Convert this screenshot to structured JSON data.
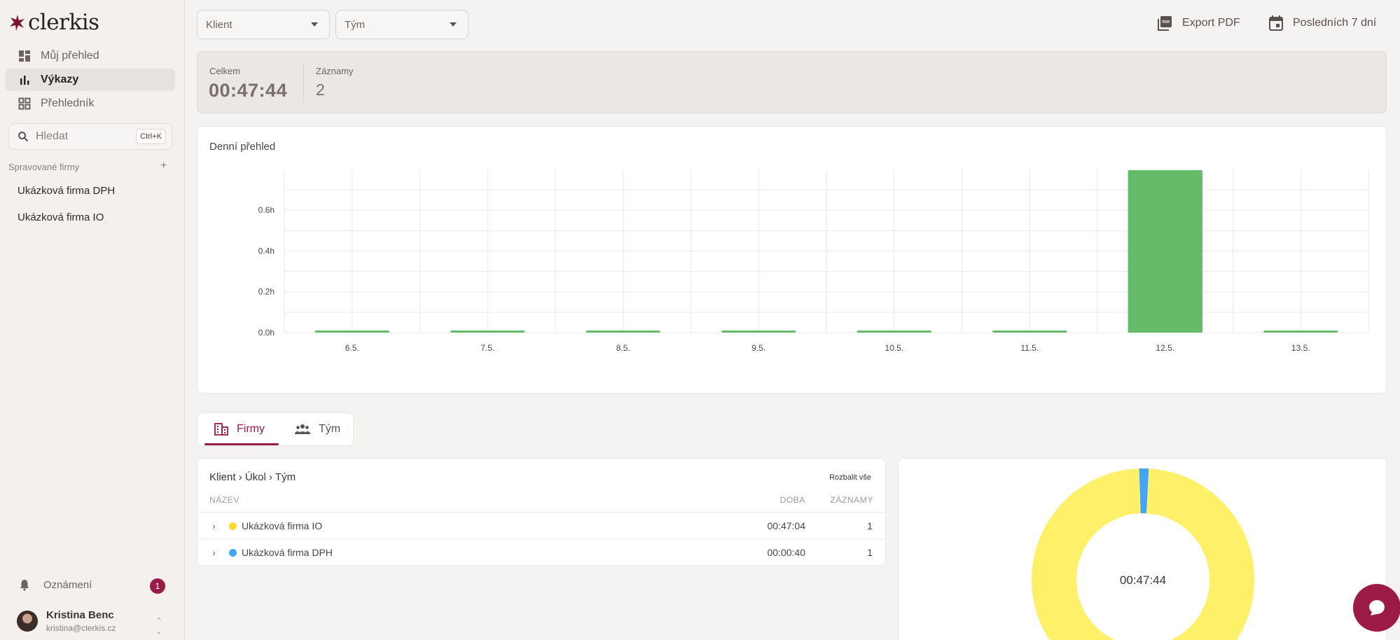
{
  "app": {
    "name": "clerkis",
    "brand_color": "#9b1b46"
  },
  "sidebar": {
    "nav": [
      {
        "label": "Můj přehled",
        "icon": "dashboard-icon"
      },
      {
        "label": "Výkazy",
        "icon": "bar-chart-icon",
        "active": true
      },
      {
        "label": "Přehledník",
        "icon": "grid-icon"
      }
    ],
    "search": {
      "placeholder": "Hledat",
      "shortcut": "Ctrl+K"
    },
    "managed_title": "Spravované firmy",
    "add_symbol": "+",
    "firms": [
      "Ukázková firma DPH",
      "Ukázková firma IO"
    ],
    "notifications": {
      "label": "Oznámení",
      "count": "1"
    },
    "user": {
      "name": "Kristina Benc",
      "email": "kristina@clerkis.cz"
    }
  },
  "toolbar": {
    "client_select": "Klient",
    "team_select": "Tým",
    "export_label": "Export PDF",
    "range_label": "Posledních 7 dní"
  },
  "summary": {
    "total_label": "Celkem",
    "total_value": "00:47:44",
    "records_label": "Záznamy",
    "records_value": "2"
  },
  "daily": {
    "title": "Denní přehled"
  },
  "chart_data": {
    "type": "bar",
    "title": "Denní přehled",
    "categories": [
      "6.5.",
      "7.5.",
      "8.5.",
      "9.5.",
      "10.5.",
      "11.5.",
      "12.5.",
      "13.5."
    ],
    "values": [
      0,
      0,
      0,
      0,
      0,
      0,
      0.7956,
      0
    ],
    "y_ticks": [
      "0.0h",
      "0.2h",
      "0.4h",
      "0.6h"
    ],
    "ylim": [
      0,
      0.7956
    ],
    "bar_color": "#66bb6a",
    "grid": true
  },
  "tabs": [
    {
      "label": "Firmy",
      "icon": "building-icon",
      "active": true
    },
    {
      "label": "Tým",
      "icon": "people-icon"
    }
  ],
  "table": {
    "title": "Klient › Úkol › Tým",
    "expand_all": "Rozbalit vše",
    "headers": {
      "name": "NÁZEV",
      "duration": "DOBA",
      "records": "ZÁZNAMY"
    },
    "rows": [
      {
        "name": "Ukázková firma IO",
        "duration": "00:47:04",
        "records": "1",
        "color": "#fdd835"
      },
      {
        "name": "Ukázková firma DPH",
        "duration": "00:00:40",
        "records": "1",
        "color": "#42a5f5"
      }
    ]
  },
  "donut": {
    "center_label": "00:47:44",
    "slices": [
      {
        "name": "Ukázková firma IO",
        "value": 2824,
        "color": "#fff06a"
      },
      {
        "name": "Ukázková firma DPH",
        "value": 40,
        "color": "#42a5f5"
      }
    ]
  }
}
